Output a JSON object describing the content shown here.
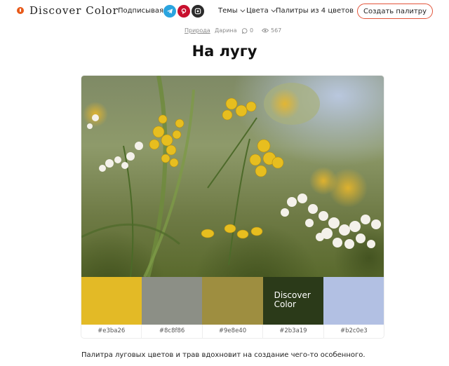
{
  "header": {
    "logo_text": "Discover Color",
    "subscribe_label": "Подписываясь:",
    "social": [
      {
        "name": "telegram-icon",
        "color": "#2aa4df"
      },
      {
        "name": "pinterest-icon",
        "color": "#c8102e"
      },
      {
        "name": "dzen-icon",
        "color": "#2b2b2b"
      }
    ],
    "nav": {
      "themes": "Темы",
      "colors": "Цвета",
      "palettes": "Палитры из 4 цветов"
    },
    "create_button": "Создать палитру"
  },
  "meta": {
    "category": "Природа",
    "author": "Дарина",
    "comments": "0",
    "views": "567"
  },
  "title": "На лугу",
  "palette": {
    "brand_overlay": "Discover Color",
    "colors": [
      {
        "hex": "#e3ba26",
        "label": "#e3ba26"
      },
      {
        "hex": "#8c8f86",
        "label": "#8c8f86"
      },
      {
        "hex": "#9e8e40",
        "label": "#9e8e40"
      },
      {
        "hex": "#2b3a19",
        "label": "#2b3a19"
      },
      {
        "hex": "#b2c0e3",
        "label": "#b2c0e3"
      }
    ]
  },
  "description": "Палитра луговых цветов и трав вдохновит на создание чего-то особенного."
}
